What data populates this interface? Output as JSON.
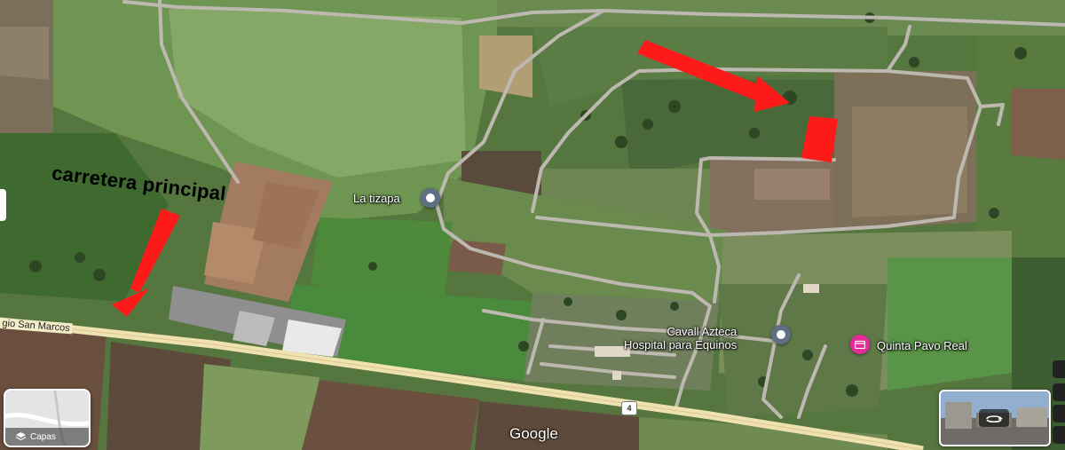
{
  "annotation": {
    "label": "carretera principal",
    "arrow_color": "#ff1a1a",
    "marker_color": "#ff1a1a"
  },
  "places": [
    {
      "id": "la-tizapa",
      "lines": [
        "La tizapa"
      ],
      "pin_color": "#5f6f86",
      "pin_type": "landmark"
    },
    {
      "id": "cavall-azteca",
      "lines": [
        "Cavall Azteca",
        "Hospital para Equinos"
      ],
      "pin_color": "#5f6f86",
      "pin_type": "landmark"
    },
    {
      "id": "quinta-pavo-real",
      "lines": [
        "Quinta Pavo Real"
      ],
      "pin_color": "#e52b9a",
      "pin_type": "event-venue"
    }
  ],
  "road": {
    "name": "gio San Marcos",
    "shield": "4",
    "color": "#efe2b0"
  },
  "controls": {
    "layers_label": "Capas",
    "layers_icon": "layers-icon",
    "street_view_icon": "rotate-360-icon"
  },
  "attribution": "Google",
  "colors": {
    "field_green": "#5f8a45",
    "dark_green": "#2f4a25",
    "dirt": "#8d7a62",
    "unpaved_road": "#b8b3ab"
  }
}
